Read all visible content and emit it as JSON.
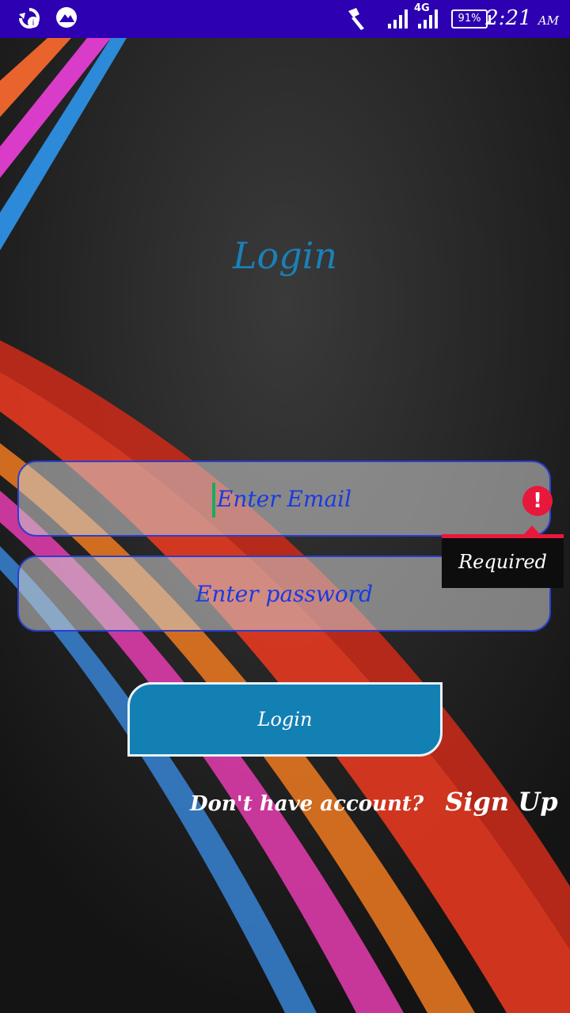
{
  "status_bar": {
    "time": "2:21",
    "ampm": "AM",
    "battery": "91%",
    "network": "4G"
  },
  "login": {
    "title": "Login",
    "email_placeholder": "Enter Email",
    "password_placeholder": "Enter password",
    "error_text": "Required",
    "button_label": "Login",
    "prompt": "Don't have account?",
    "signup_link": "Sign Up"
  },
  "colors": {
    "status_bar": "#2d00b1",
    "accent": "#1380b4",
    "error": "#e8183c",
    "input_border": "#2a3fd0"
  }
}
